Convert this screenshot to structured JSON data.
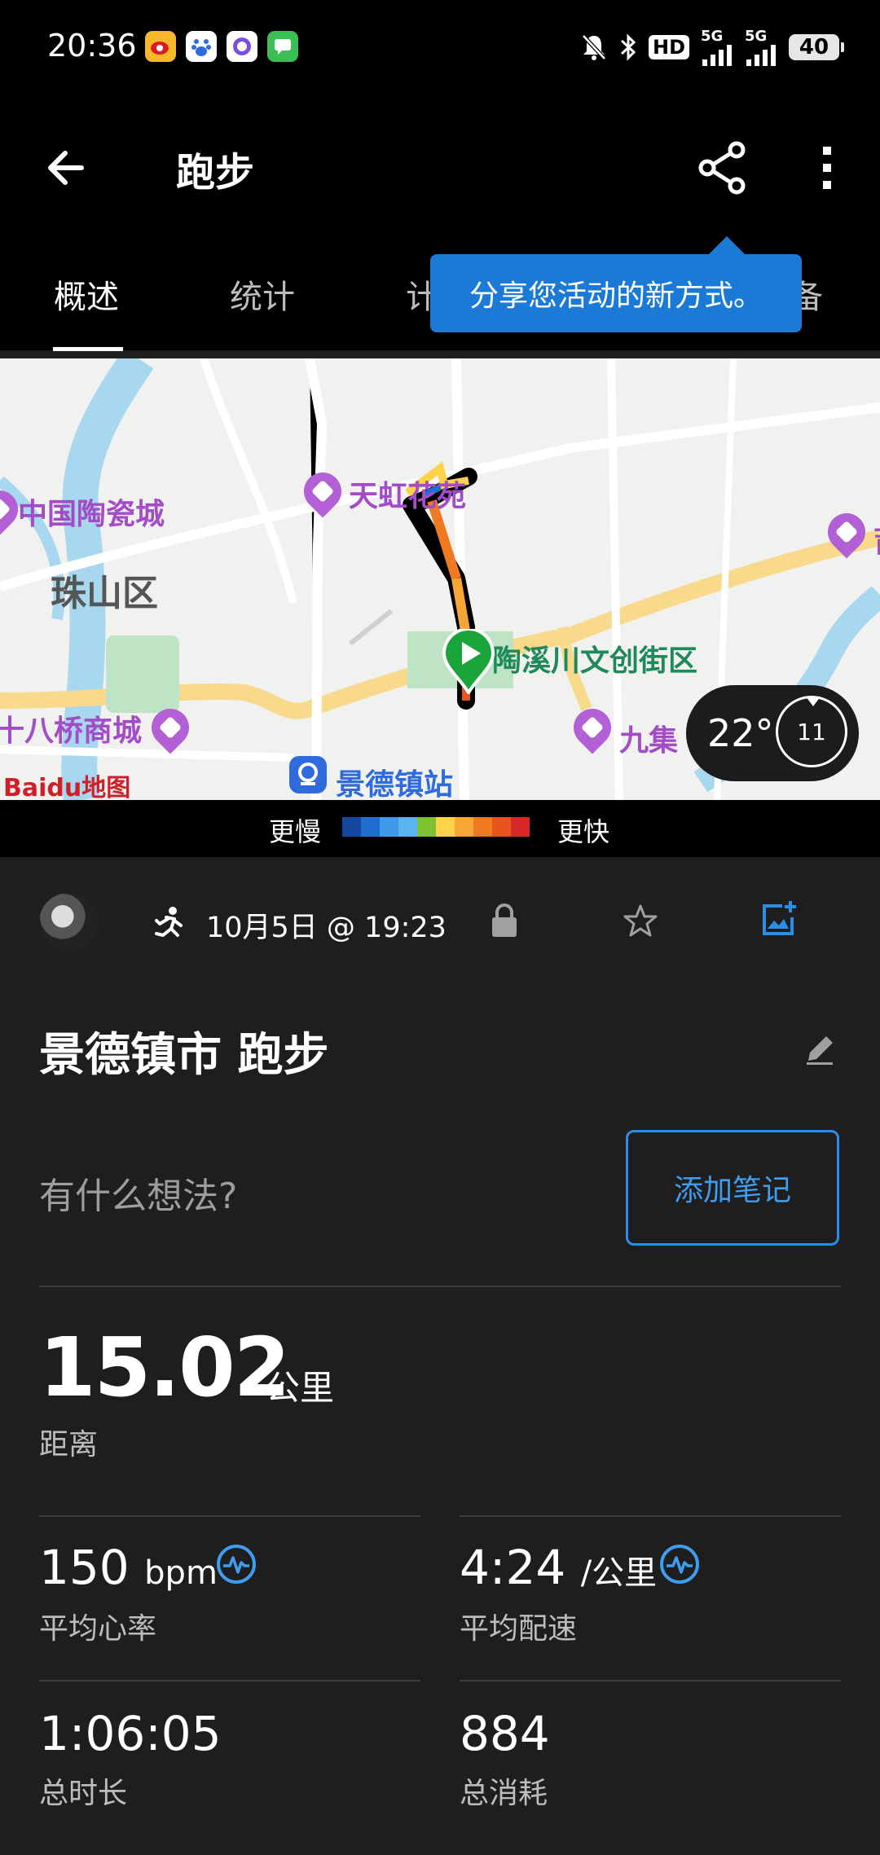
{
  "status_bar": {
    "time": "20:36",
    "notifications": [
      "weibo-icon",
      "baidu-icon",
      "browser-icon",
      "messages-icon"
    ],
    "hd_badge": "HD",
    "network_5g_a": "5G",
    "network_5g_b": "5G",
    "battery": "40"
  },
  "app_bar": {
    "title": "跑步",
    "icons": [
      "back-arrow-icon",
      "share-icon",
      "more-vert-icon"
    ]
  },
  "tabs": [
    {
      "label": "概述",
      "active": true
    },
    {
      "label": "统计",
      "active": false
    },
    {
      "label": "计",
      "active": false
    },
    {
      "label": "备",
      "active": false
    }
  ],
  "tooltip": {
    "text": "分享您活动的新方式。"
  },
  "map": {
    "labels": {
      "tianhong": "天虹花苑",
      "zhongguo": "中国陶瓷城",
      "zhushan": "珠山区",
      "taoxi": "陶溪川文创街区",
      "shibaqiao": "十八桥商城",
      "jiuji": "九集",
      "station": "景德镇站",
      "edge_poi": "莆"
    },
    "baidu_logo": "Baidu地图",
    "weather": {
      "temperature": "22°",
      "wind": "11"
    }
  },
  "legend": {
    "slower": "更慢",
    "faster": "更快",
    "colors": [
      "#1546a0",
      "#1e6fd0",
      "#3f9be8",
      "#5bb3f0",
      "#7cc233",
      "#ffd24a",
      "#f7a534",
      "#f07a22",
      "#e8551c",
      "#d62828"
    ]
  },
  "activity": {
    "date": "10月5日 @ 19:23",
    "title": "景德镇市 跑步",
    "note_placeholder": "有什么想法?",
    "add_note": "添加笔记"
  },
  "stats": {
    "distance": {
      "value": "15.02",
      "unit": "公里",
      "label": "距离"
    },
    "avg_hr": {
      "value": "150",
      "unit": "bpm",
      "label": "平均心率"
    },
    "avg_pace": {
      "value": "4:24",
      "unit": "/公里",
      "label": "平均配速"
    },
    "duration": {
      "value": "1:06:05",
      "label": "总时长"
    },
    "calories": {
      "value": "884",
      "label": "总消耗"
    }
  },
  "accent_colors": {
    "tooltip": "#1a7ad6",
    "button_border": "#2a8ee8",
    "poi_purple": "#a24cc8",
    "poi_green": "#1e8a5a"
  }
}
